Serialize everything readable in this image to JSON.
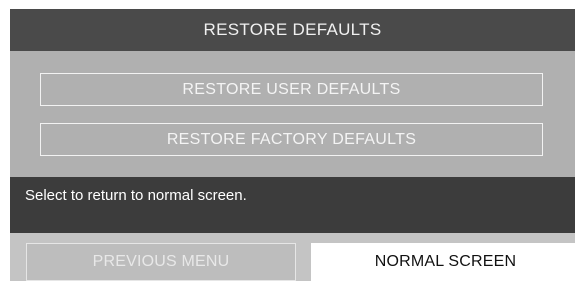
{
  "window": {
    "title": "RESTORE DEFAULTS"
  },
  "options": {
    "restore_user_defaults": "RESTORE USER DEFAULTS",
    "restore_factory_defaults": "RESTORE FACTORY DEFAULTS"
  },
  "help": {
    "text": "Select to return to normal screen."
  },
  "nav": {
    "previous_menu": "PREVIOUS MENU",
    "normal_screen": "NORMAL SCREEN",
    "selected": "normal_screen"
  },
  "colors": {
    "title_bar": "#4a4a4a",
    "panel": "#b0b0b0",
    "help_bar": "#3c3c3c",
    "selected_button": "#ffffff"
  }
}
